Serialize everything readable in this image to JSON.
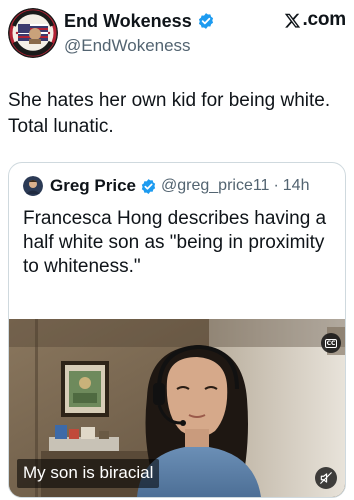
{
  "author": {
    "display_name": "End Wokeness",
    "handle": "@EndWokeness",
    "verified": true,
    "avatar_icon": "end-wokeness-badge-avatar"
  },
  "brand": {
    "label": ".com",
    "icon": "x-logo-icon"
  },
  "tweet": {
    "text": "She hates her own kid for being white.\nTotal lunatic."
  },
  "quote": {
    "display_name": "Greg Price",
    "handle": "@greg_price11",
    "separator": "·",
    "time": "14h",
    "verified": true,
    "text": "Francesca Hong describes having a half white son as \"being in proximity to whiteness.\""
  },
  "media": {
    "caption": "My son is biracial",
    "cc_label": "CC",
    "mute_icon": "muted-speaker-icon"
  },
  "colors": {
    "text_primary": "#0f1419",
    "text_secondary": "#536471",
    "verified_blue": "#1d9bf0",
    "border": "#cfd9de"
  }
}
